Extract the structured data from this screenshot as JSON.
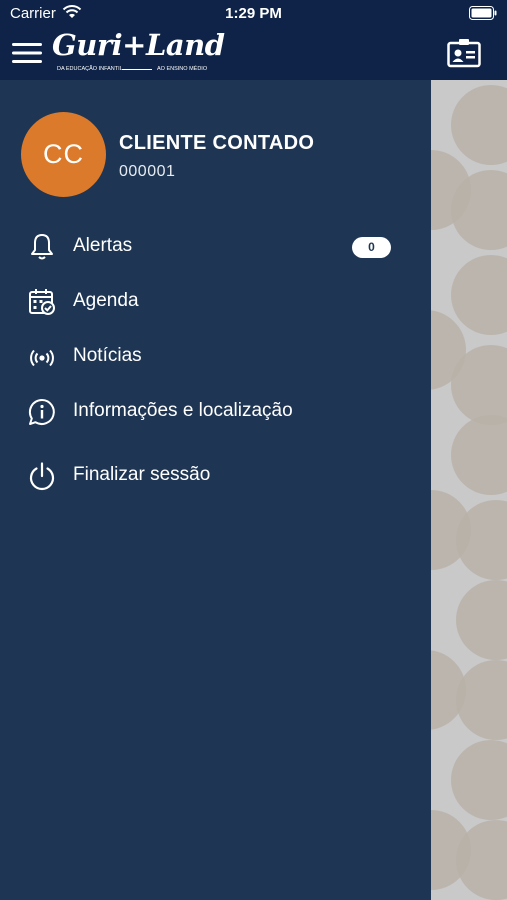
{
  "status_bar": {
    "carrier": "Carrier",
    "time": "1:29 PM"
  },
  "header": {
    "logo_brand": "Guri+Land",
    "logo_tagline_left": "DA EDUCAÇÃO INFANTIL",
    "logo_tagline_right": "AO ENSINO MÉDIO"
  },
  "user": {
    "initials": "CC",
    "name": "CLIENTE CONTADO",
    "id": "000001"
  },
  "menu": {
    "alerts": {
      "label": "Alertas",
      "icon": "bell-icon",
      "badge": "0"
    },
    "agenda": {
      "label": "Agenda",
      "icon": "calendar-check-icon"
    },
    "news": {
      "label": "Notícias",
      "icon": "broadcast-icon"
    },
    "info": {
      "label": "Informações e localização",
      "icon": "info-chat-icon"
    },
    "logout": {
      "label": "Finalizar sessão",
      "icon": "power-icon"
    }
  },
  "colors": {
    "header_bg": "#0e2347",
    "drawer_bg": "#1e3654",
    "avatar_bg": "#dc7a2b",
    "badge_bg": "#ffffff"
  }
}
